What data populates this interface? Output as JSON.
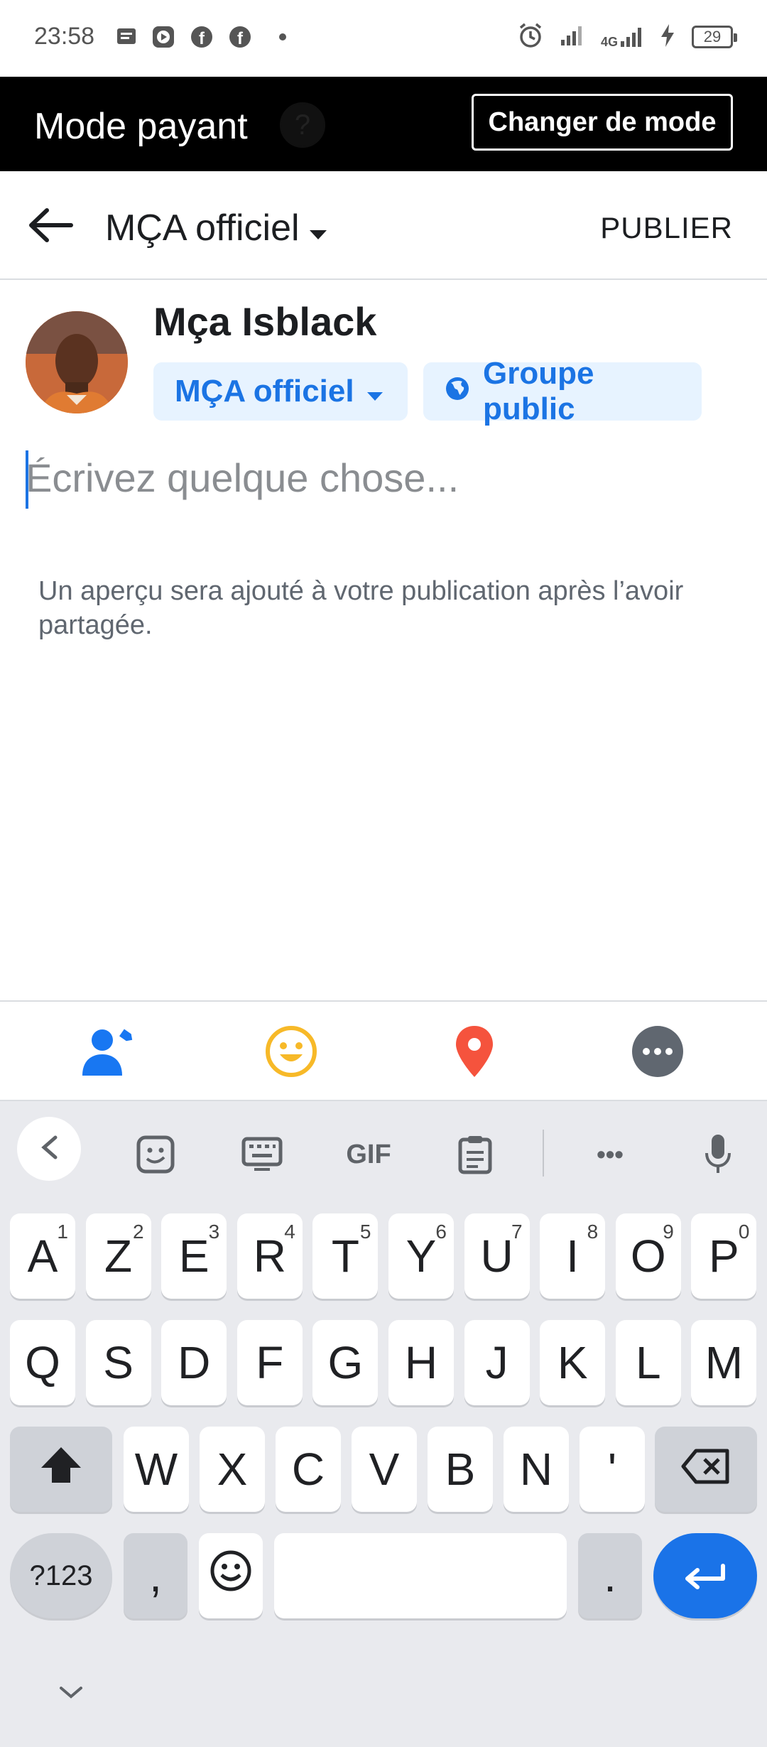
{
  "status_bar": {
    "time": "23:58",
    "network": "4G",
    "battery": "29"
  },
  "mode_bar": {
    "title": "Mode payant",
    "help_glyph": "?",
    "button_label": "Changer de mode"
  },
  "header": {
    "title": "MÇA officiel",
    "publish_label": "PUBLIER"
  },
  "author": {
    "name": "Mça Isblack",
    "audience_chip": "MÇA officiel",
    "privacy_chip": "Groupe public"
  },
  "composer": {
    "placeholder": "Écrivez quelque chose...",
    "preview_note": "Un aperçu sera ajouté à votre publication après l’avoir partagée."
  },
  "actions": [
    {
      "icon": "tag-people-icon",
      "color": "#1877f2"
    },
    {
      "icon": "emoji-icon",
      "color": "#f7b928"
    },
    {
      "icon": "location-pin-icon",
      "color": "#f5533d"
    },
    {
      "icon": "more-icon",
      "color": "#606770"
    }
  ],
  "keyboard": {
    "toolbar": {
      "gif_label": "GIF",
      "more_label": "•••"
    },
    "row1": [
      {
        "k": "A",
        "sup": "1"
      },
      {
        "k": "Z",
        "sup": "2"
      },
      {
        "k": "E",
        "sup": "3"
      },
      {
        "k": "R",
        "sup": "4"
      },
      {
        "k": "T",
        "sup": "5"
      },
      {
        "k": "Y",
        "sup": "6"
      },
      {
        "k": "U",
        "sup": "7"
      },
      {
        "k": "I",
        "sup": "8"
      },
      {
        "k": "O",
        "sup": "9"
      },
      {
        "k": "P",
        "sup": "0"
      }
    ],
    "row2": [
      "Q",
      "S",
      "D",
      "F",
      "G",
      "H",
      "J",
      "K",
      "L",
      "M"
    ],
    "row3": [
      "W",
      "X",
      "C",
      "V",
      "B",
      "N",
      "'"
    ],
    "row4": {
      "symbols": "?123",
      "comma": ",",
      "period": "."
    }
  },
  "colors": {
    "accent": "#1b74e4",
    "chip_bg": "#e7f3ff",
    "banner_bg": "#000000"
  }
}
